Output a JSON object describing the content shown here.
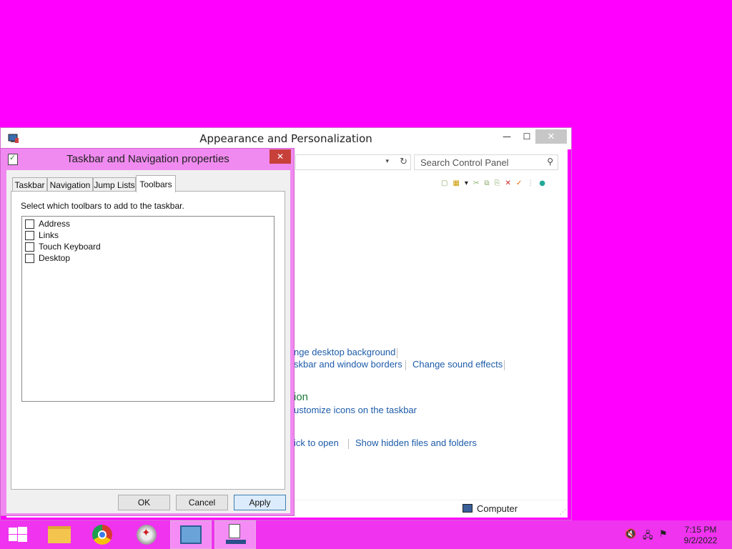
{
  "control_panel": {
    "title": "Appearance and Personalization",
    "minimize_glyph": "—",
    "maximize_glyph": "☐",
    "close_glyph": "✕",
    "search_placeholder": "Search Control Panel",
    "links": {
      "desktop_background": "nge desktop background",
      "taskbar_borders": "skbar and window borders",
      "sound_effects": "Change sound effects",
      "customize_icons": "ustomize icons on the taskbar",
      "click_to_open": "ick to open",
      "hidden_files": "Show hidden files and folders"
    },
    "heading_taskbar": "ion",
    "status_computer": "Computer"
  },
  "dialog": {
    "title": "Taskbar and Navigation properties",
    "close_glyph": "✕",
    "tabs": [
      "Taskbar",
      "Navigation",
      "Jump Lists",
      "Toolbars"
    ],
    "active_tab": "Toolbars",
    "instruction": "Select which toolbars to add to the taskbar.",
    "toolbars": [
      {
        "label": "Address",
        "checked": false
      },
      {
        "label": "Links",
        "checked": false
      },
      {
        "label": "Touch Keyboard",
        "checked": false
      },
      {
        "label": "Desktop",
        "checked": false
      }
    ],
    "buttons": {
      "ok": "OK",
      "cancel": "Cancel",
      "apply": "Apply"
    }
  },
  "taskbar": {
    "pinned": [
      "start-button",
      "file-explorer",
      "chrome",
      "compass-app",
      "control-panel",
      "taskbar-properties"
    ],
    "clock_time": "7:15 PM",
    "clock_date": "9/2/2022"
  },
  "colors": {
    "desktop": "#ff00ff",
    "accent": "#f08af0",
    "link": "#1e5ca8",
    "heading": "#1e7a3c"
  }
}
